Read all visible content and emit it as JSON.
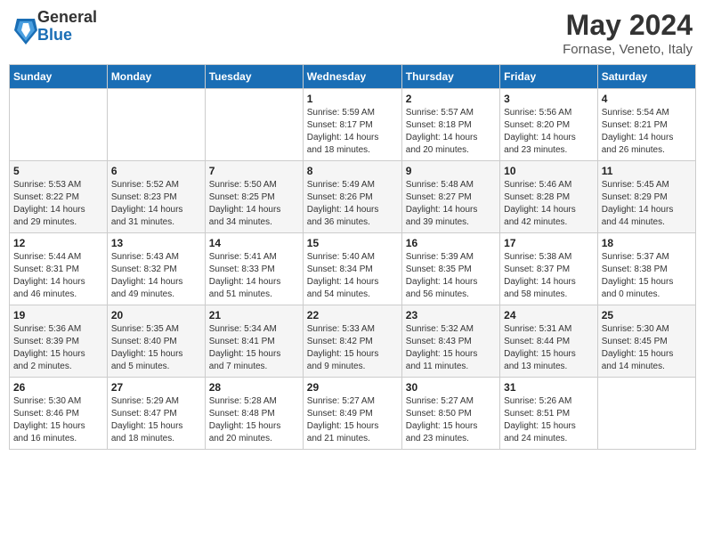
{
  "header": {
    "logo_general": "General",
    "logo_blue": "Blue",
    "month_title": "May 2024",
    "location": "Fornase, Veneto, Italy"
  },
  "days_of_week": [
    "Sunday",
    "Monday",
    "Tuesday",
    "Wednesday",
    "Thursday",
    "Friday",
    "Saturday"
  ],
  "weeks": [
    [
      {
        "day": "",
        "info": ""
      },
      {
        "day": "",
        "info": ""
      },
      {
        "day": "",
        "info": ""
      },
      {
        "day": "1",
        "info": "Sunrise: 5:59 AM\nSunset: 8:17 PM\nDaylight: 14 hours\nand 18 minutes."
      },
      {
        "day": "2",
        "info": "Sunrise: 5:57 AM\nSunset: 8:18 PM\nDaylight: 14 hours\nand 20 minutes."
      },
      {
        "day": "3",
        "info": "Sunrise: 5:56 AM\nSunset: 8:20 PM\nDaylight: 14 hours\nand 23 minutes."
      },
      {
        "day": "4",
        "info": "Sunrise: 5:54 AM\nSunset: 8:21 PM\nDaylight: 14 hours\nand 26 minutes."
      }
    ],
    [
      {
        "day": "5",
        "info": "Sunrise: 5:53 AM\nSunset: 8:22 PM\nDaylight: 14 hours\nand 29 minutes."
      },
      {
        "day": "6",
        "info": "Sunrise: 5:52 AM\nSunset: 8:23 PM\nDaylight: 14 hours\nand 31 minutes."
      },
      {
        "day": "7",
        "info": "Sunrise: 5:50 AM\nSunset: 8:25 PM\nDaylight: 14 hours\nand 34 minutes."
      },
      {
        "day": "8",
        "info": "Sunrise: 5:49 AM\nSunset: 8:26 PM\nDaylight: 14 hours\nand 36 minutes."
      },
      {
        "day": "9",
        "info": "Sunrise: 5:48 AM\nSunset: 8:27 PM\nDaylight: 14 hours\nand 39 minutes."
      },
      {
        "day": "10",
        "info": "Sunrise: 5:46 AM\nSunset: 8:28 PM\nDaylight: 14 hours\nand 42 minutes."
      },
      {
        "day": "11",
        "info": "Sunrise: 5:45 AM\nSunset: 8:29 PM\nDaylight: 14 hours\nand 44 minutes."
      }
    ],
    [
      {
        "day": "12",
        "info": "Sunrise: 5:44 AM\nSunset: 8:31 PM\nDaylight: 14 hours\nand 46 minutes."
      },
      {
        "day": "13",
        "info": "Sunrise: 5:43 AM\nSunset: 8:32 PM\nDaylight: 14 hours\nand 49 minutes."
      },
      {
        "day": "14",
        "info": "Sunrise: 5:41 AM\nSunset: 8:33 PM\nDaylight: 14 hours\nand 51 minutes."
      },
      {
        "day": "15",
        "info": "Sunrise: 5:40 AM\nSunset: 8:34 PM\nDaylight: 14 hours\nand 54 minutes."
      },
      {
        "day": "16",
        "info": "Sunrise: 5:39 AM\nSunset: 8:35 PM\nDaylight: 14 hours\nand 56 minutes."
      },
      {
        "day": "17",
        "info": "Sunrise: 5:38 AM\nSunset: 8:37 PM\nDaylight: 14 hours\nand 58 minutes."
      },
      {
        "day": "18",
        "info": "Sunrise: 5:37 AM\nSunset: 8:38 PM\nDaylight: 15 hours\nand 0 minutes."
      }
    ],
    [
      {
        "day": "19",
        "info": "Sunrise: 5:36 AM\nSunset: 8:39 PM\nDaylight: 15 hours\nand 2 minutes."
      },
      {
        "day": "20",
        "info": "Sunrise: 5:35 AM\nSunset: 8:40 PM\nDaylight: 15 hours\nand 5 minutes."
      },
      {
        "day": "21",
        "info": "Sunrise: 5:34 AM\nSunset: 8:41 PM\nDaylight: 15 hours\nand 7 minutes."
      },
      {
        "day": "22",
        "info": "Sunrise: 5:33 AM\nSunset: 8:42 PM\nDaylight: 15 hours\nand 9 minutes."
      },
      {
        "day": "23",
        "info": "Sunrise: 5:32 AM\nSunset: 8:43 PM\nDaylight: 15 hours\nand 11 minutes."
      },
      {
        "day": "24",
        "info": "Sunrise: 5:31 AM\nSunset: 8:44 PM\nDaylight: 15 hours\nand 13 minutes."
      },
      {
        "day": "25",
        "info": "Sunrise: 5:30 AM\nSunset: 8:45 PM\nDaylight: 15 hours\nand 14 minutes."
      }
    ],
    [
      {
        "day": "26",
        "info": "Sunrise: 5:30 AM\nSunset: 8:46 PM\nDaylight: 15 hours\nand 16 minutes."
      },
      {
        "day": "27",
        "info": "Sunrise: 5:29 AM\nSunset: 8:47 PM\nDaylight: 15 hours\nand 18 minutes."
      },
      {
        "day": "28",
        "info": "Sunrise: 5:28 AM\nSunset: 8:48 PM\nDaylight: 15 hours\nand 20 minutes."
      },
      {
        "day": "29",
        "info": "Sunrise: 5:27 AM\nSunset: 8:49 PM\nDaylight: 15 hours\nand 21 minutes."
      },
      {
        "day": "30",
        "info": "Sunrise: 5:27 AM\nSunset: 8:50 PM\nDaylight: 15 hours\nand 23 minutes."
      },
      {
        "day": "31",
        "info": "Sunrise: 5:26 AM\nSunset: 8:51 PM\nDaylight: 15 hours\nand 24 minutes."
      },
      {
        "day": "",
        "info": ""
      }
    ]
  ]
}
